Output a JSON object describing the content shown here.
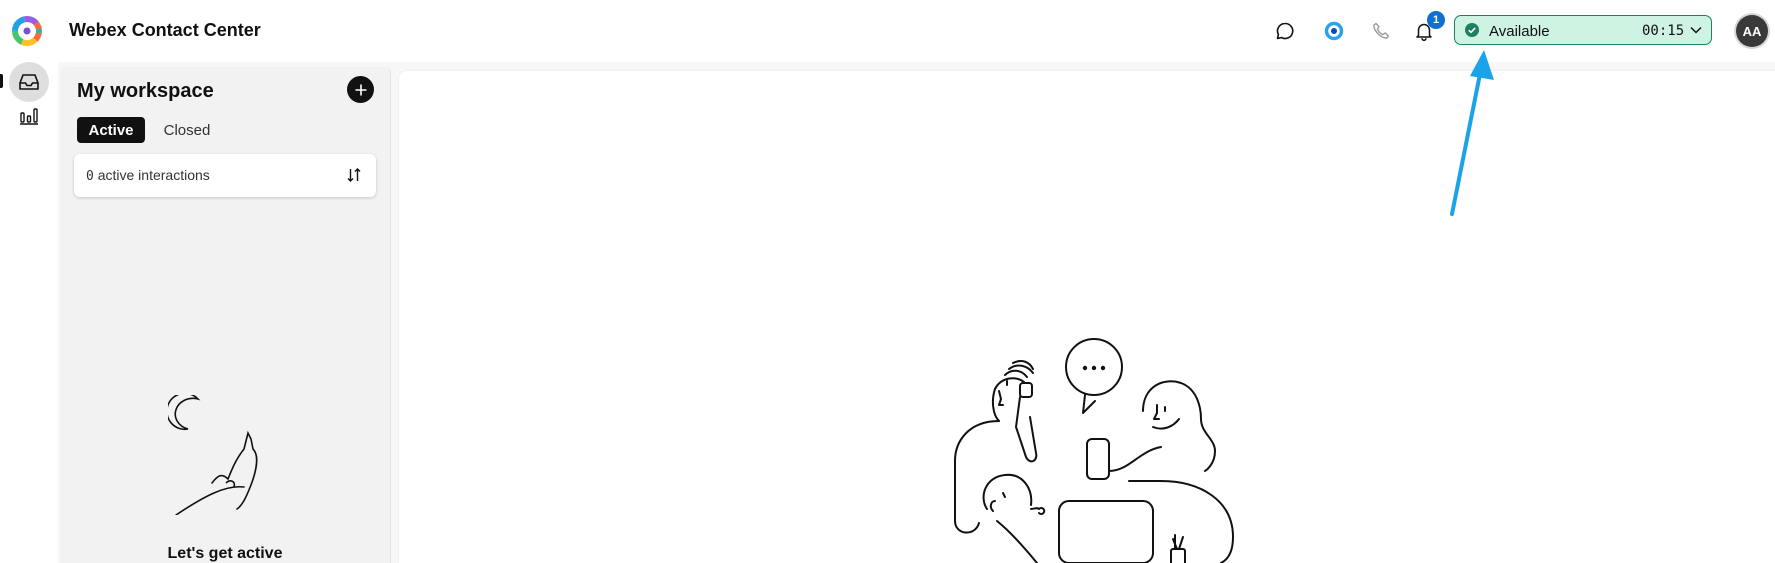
{
  "app": {
    "title": "Webex Contact Center"
  },
  "header": {
    "icons": [
      "chat-bubble-icon",
      "webex-app-icon",
      "phone-icon",
      "bell-icon"
    ],
    "notifications_count": "1",
    "status": {
      "label": "Available",
      "timer": "00:15",
      "color": "#cff3e3",
      "border_color": "#1d805f"
    },
    "avatar_initials": "AA"
  },
  "nav": {
    "items": [
      {
        "name": "inbox",
        "icon": "inbox-tray-icon",
        "active": true
      },
      {
        "name": "analytics",
        "icon": "bar-chart-icon",
        "active": false
      }
    ]
  },
  "workspace": {
    "title": "My workspace",
    "tabs": [
      {
        "label": "Active",
        "selected": true
      },
      {
        "label": "Closed",
        "selected": false
      }
    ],
    "interactions": {
      "count": "0",
      "label": "active interactions"
    },
    "empty_state": {
      "title": "Let's get active",
      "illustration": "moon-and-howling-wolf"
    }
  },
  "main": {
    "illustration": "people-chatting-around-table"
  },
  "annotation": {
    "arrow_color": "#1aa3e8",
    "target": "status-pill"
  }
}
